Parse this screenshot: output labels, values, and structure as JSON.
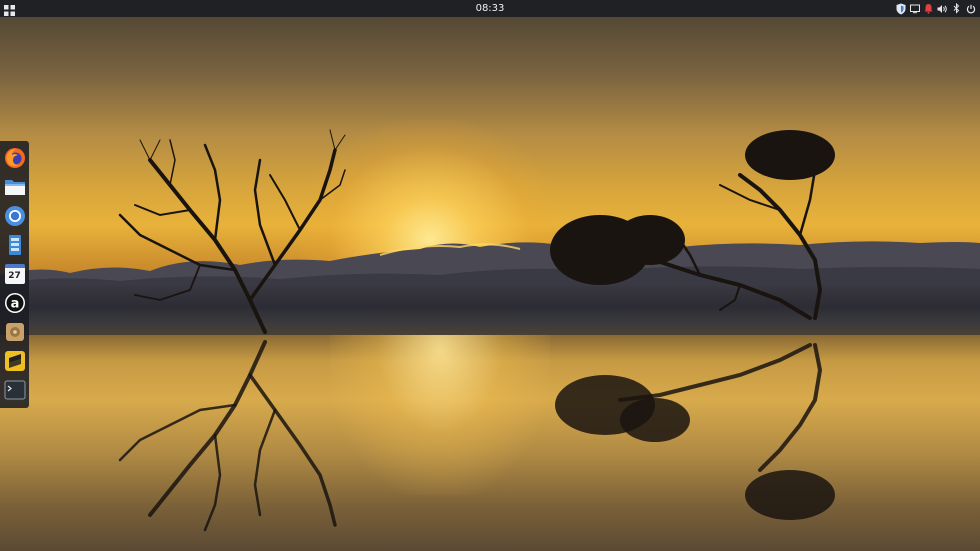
{
  "top_panel": {
    "clock": "08:33",
    "apps_icon": "grid-icon",
    "tray_icons": [
      "shield-icon",
      "display-icon",
      "notification-icon",
      "volume-icon",
      "bluetooth-icon",
      "power-icon"
    ],
    "notification_color": "#e04040"
  },
  "dock": {
    "items": [
      {
        "name": "firefox",
        "icon": "firefox-icon"
      },
      {
        "name": "files",
        "icon": "folder-icon"
      },
      {
        "name": "chromium",
        "icon": "chromium-icon"
      },
      {
        "name": "archive",
        "icon": "archive-icon"
      },
      {
        "name": "calendar",
        "icon": "calendar-icon",
        "label": "27"
      },
      {
        "name": "appcenter",
        "icon": "appcenter-icon"
      },
      {
        "name": "disks",
        "icon": "disk-icon"
      },
      {
        "name": "sublime",
        "icon": "sublime-icon"
      },
      {
        "name": "terminal",
        "icon": "terminal-icon"
      }
    ]
  },
  "wallpaper": {
    "subject": "sunset-over-water-with-trees"
  }
}
